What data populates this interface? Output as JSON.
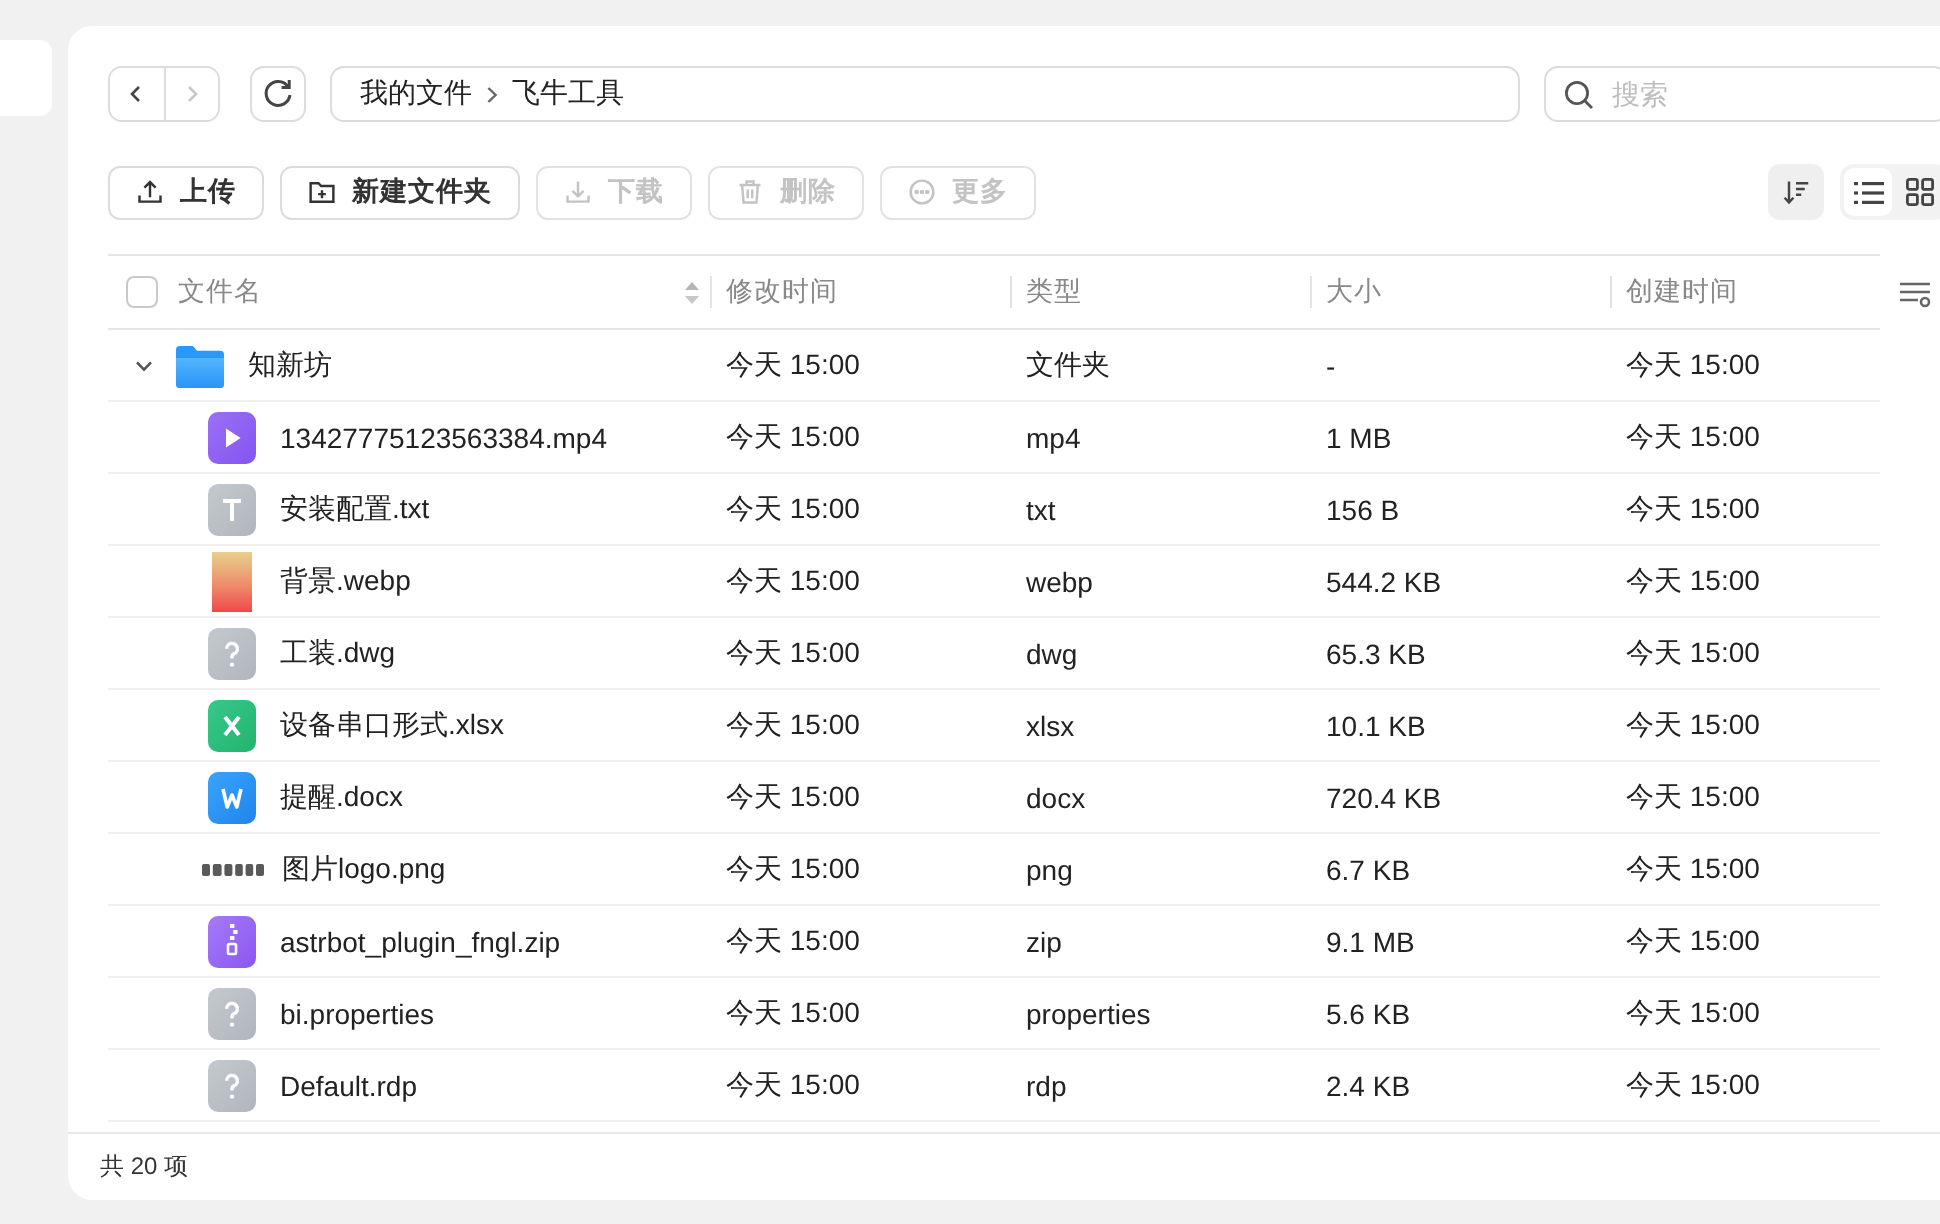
{
  "nav": [
    {
      "kind": "back",
      "disabled": false
    },
    {
      "kind": "forward",
      "disabled": true
    }
  ],
  "breadcrumb": [
    "我的文件",
    "飞牛工具"
  ],
  "search": {
    "placeholder": "搜索"
  },
  "toolbar": [
    {
      "kind": "upload",
      "label": "上传",
      "disabled": false
    },
    {
      "kind": "create",
      "label": "新建文件夹",
      "disabled": false
    },
    {
      "kind": "download",
      "label": "下载",
      "disabled": true
    },
    {
      "kind": "delete",
      "label": "删除",
      "disabled": true
    },
    {
      "kind": "more",
      "label": "更多",
      "disabled": true
    }
  ],
  "view_modes": [
    {
      "kind": "list",
      "selected": true
    },
    {
      "kind": "grid",
      "selected": false
    }
  ],
  "table": {
    "select_all_checked": false,
    "columns": [
      "文件名",
      "修改时间",
      "类型",
      "大小",
      "创建时间"
    ],
    "rows": [
      {
        "kind": "folder",
        "name": "知新坊",
        "expanded": true,
        "modified": "今天 15:00",
        "type": "文件夹",
        "size": "-",
        "created": "今天 15:00",
        "children": [
          {
            "kind": "video",
            "name": "13427775123563384.mp4",
            "modified": "今天 15:00",
            "type": "mp4",
            "size": "1 MB",
            "created": "今天 15:00"
          },
          {
            "kind": "text",
            "name": "安装配置.txt",
            "modified": "今天 15:00",
            "type": "txt",
            "size": "156 B",
            "created": "今天 15:00"
          },
          {
            "kind": "photo",
            "name": "背景.webp",
            "modified": "今天 15:00",
            "type": "webp",
            "size": "544.2 KB",
            "created": "今天 15:00"
          },
          {
            "kind": "unknown",
            "name": "工装.dwg",
            "modified": "今天 15:00",
            "type": "dwg",
            "size": "65.3 KB",
            "created": "今天 15:00"
          },
          {
            "kind": "sheet",
            "name": "设备串口形式.xlsx",
            "modified": "今天 15:00",
            "type": "xlsx",
            "size": "10.1 KB",
            "created": "今天 15:00"
          },
          {
            "kind": "doc",
            "name": "提醒.docx",
            "modified": "今天 15:00",
            "type": "docx",
            "size": "720.4 KB",
            "created": "今天 15:00"
          },
          {
            "kind": "logo",
            "name": "图片logo.png",
            "modified": "今天 15:00",
            "type": "png",
            "size": "6.7 KB",
            "created": "今天 15:00"
          },
          {
            "kind": "archive",
            "name": "astrbot_plugin_fngl.zip",
            "modified": "今天 15:00",
            "type": "zip",
            "size": "9.1 MB",
            "created": "今天 15:00"
          },
          {
            "kind": "unknown",
            "name": "bi.properties",
            "modified": "今天 15:00",
            "type": "properties",
            "size": "5.6 KB",
            "created": "今天 15:00"
          },
          {
            "kind": "unknown",
            "name": "Default.rdp",
            "modified": "今天 15:00",
            "type": "rdp",
            "size": "2.4 KB",
            "created": "今天 15:00"
          }
        ]
      }
    ]
  },
  "status_bar": {
    "item_count": "共 20 项"
  }
}
